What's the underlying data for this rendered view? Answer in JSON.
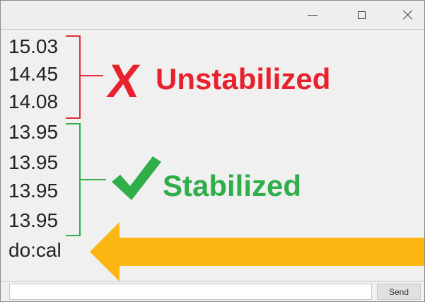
{
  "window": {
    "controls": [
      {
        "name": "minimize",
        "icon": "minimize-icon"
      },
      {
        "name": "maximize",
        "icon": "maximize-icon"
      },
      {
        "name": "close",
        "icon": "close-icon"
      }
    ]
  },
  "output": {
    "unstabilized_lines": [
      "15.03",
      "14.45",
      "14.08"
    ],
    "stabilized_lines": [
      "13.95",
      "13.95",
      "13.95",
      "13.95"
    ],
    "command_line": "do:cal"
  },
  "annotations": {
    "unstabilized": {
      "mark": "X",
      "label": "Unstabilized",
      "color": "#e8222d",
      "icon": "cross-mark-icon"
    },
    "stabilized": {
      "label": "Stabilized",
      "color": "#2fae4a",
      "icon": "check-mark-icon"
    },
    "arrow": {
      "color": "#fbb614",
      "icon": "left-arrow-icon"
    }
  },
  "input_bar": {
    "value": "",
    "send_label": "Send"
  }
}
